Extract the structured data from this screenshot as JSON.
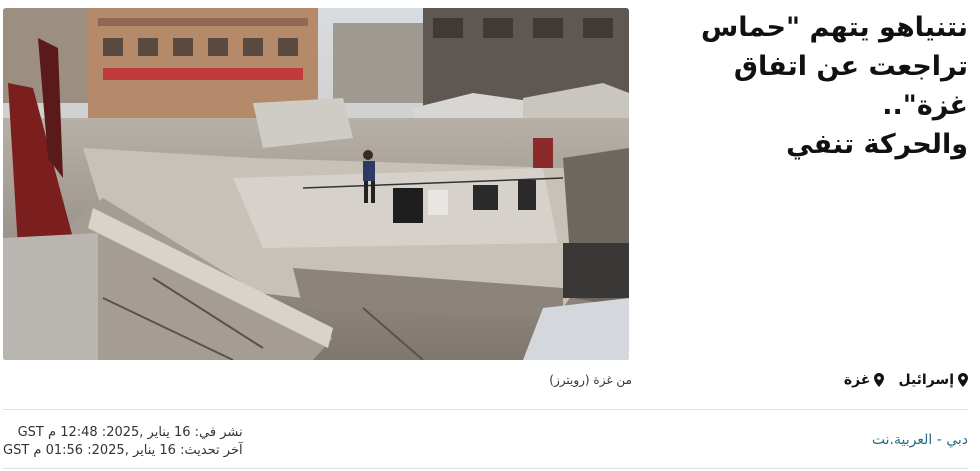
{
  "article": {
    "headline_lines": [
      "نتنياهو يتهم \"حماس",
      "تراجعت عن اتفاق غزة\"..",
      "والحركة تنفي"
    ],
    "image_caption": "من غزة (رويترز)",
    "tags": [
      {
        "label": "إسرائيل",
        "icon": "location-pin-icon"
      },
      {
        "label": "غزة",
        "icon": "location-pin-icon"
      }
    ],
    "published": "نشر في: 16 يناير ,2025: 12:48 م GST",
    "updated": "آخر تحديث: 16 يناير ,2025: 01:56 م GST",
    "byline": "دبي - العربية.نت"
  },
  "colors": {
    "byline": "#2a6b86",
    "divider": "#e1e1e1",
    "text": "#111111"
  }
}
